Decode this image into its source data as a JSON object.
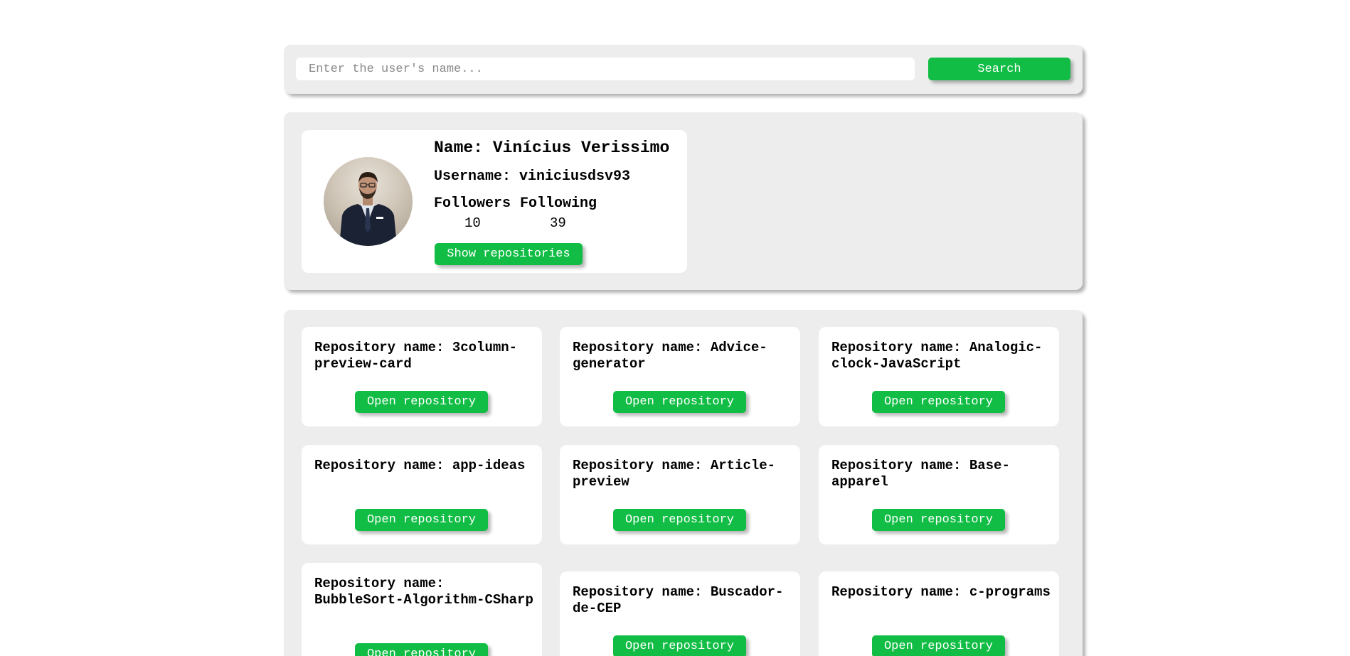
{
  "search": {
    "placeholder": "Enter the user's name...",
    "button_label": "Search"
  },
  "profile": {
    "name_label": "Name: Vinícius Verissimo",
    "username_label": "Username: viniciusdsv93",
    "followers_label": "Followers",
    "following_label": "Following",
    "followers_count": "10",
    "following_count": "39",
    "show_repos_label": "Show repositories"
  },
  "repositories": {
    "items": [
      {
        "title": "Repository name: 3column-preview-card",
        "button_label": "Open repository"
      },
      {
        "title": "Repository name: Advice-generator",
        "button_label": "Open repository"
      },
      {
        "title": "Repository name: Analogic-clock-JavaScript",
        "button_label": "Open repository"
      },
      {
        "title": "Repository name: app-ideas",
        "button_label": "Open repository"
      },
      {
        "title": "Repository name: Article-preview",
        "button_label": "Open repository"
      },
      {
        "title": "Repository name: Base-apparel",
        "button_label": "Open repository"
      },
      {
        "title": "Repository name: BubbleSort-Algorithm-CSharp",
        "button_label": "Open repository"
      },
      {
        "title": "Repository name: Buscador-de-CEP",
        "button_label": "Open repository"
      },
      {
        "title": "Repository name: c-programs",
        "button_label": "Open repository"
      }
    ]
  },
  "colors": {
    "accent": "#11bd45",
    "panel_background": "#ededed",
    "card_background": "#ffffff"
  }
}
